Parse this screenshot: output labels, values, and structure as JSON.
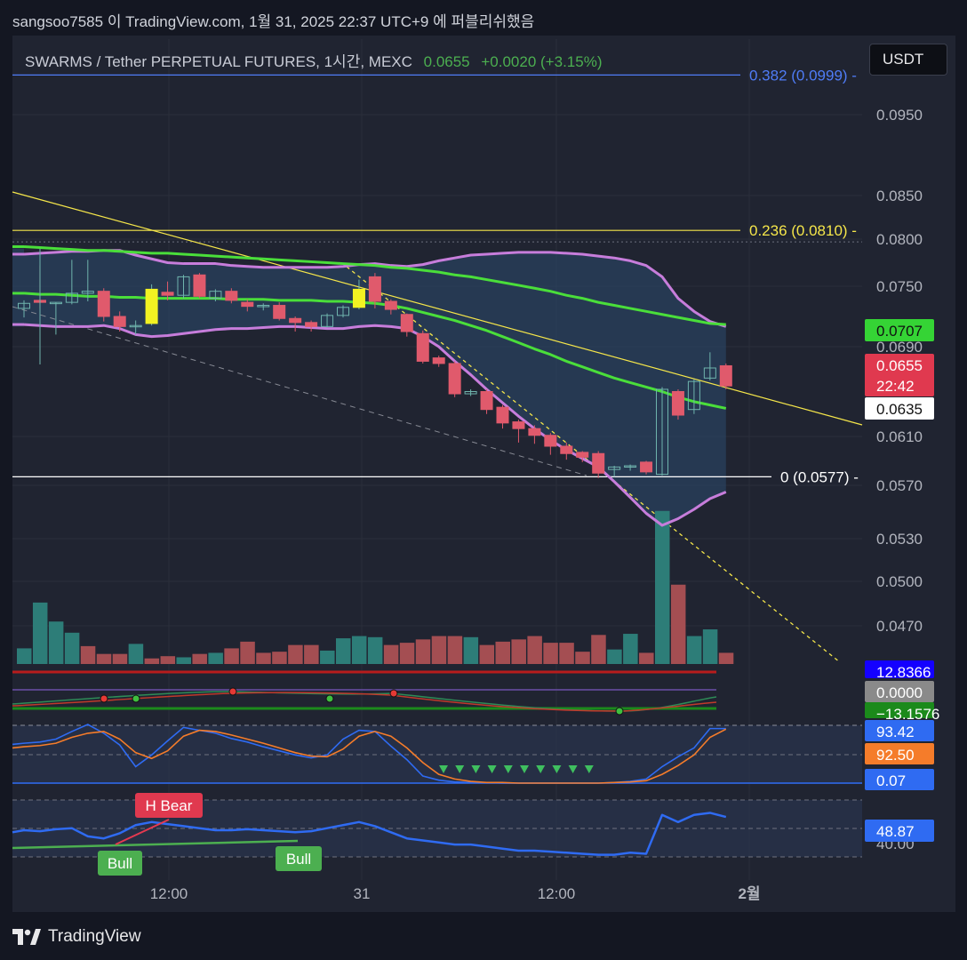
{
  "caption": "sangsoo7585 이 TradingView.com, 1월 31, 2025 22:37 UTC+9 에 퍼블리쉬했음",
  "header": {
    "symbol": "SWARMS / Tether PERPETUAL FUTURES, 1시간, MEXC",
    "price": "0.0655",
    "change": "+0.0020 (+3.15%)"
  },
  "currency_button": "USDT",
  "brand": "TradingView",
  "colors": {
    "background": "#202431",
    "up": "#26a69a",
    "down": "#ef5350",
    "bollinger": "#c77ddb",
    "ma": "#4ade3a",
    "fib_382": "#4f7cf6",
    "fib_236": "#f5e64a",
    "trendline": "#f5e64a",
    "rsi": "#2f6bf2"
  },
  "chart_data": {
    "type": "candlestick",
    "title": "SWARMS / Tether PERPETUAL FUTURES, 1시간, MEXC",
    "y_ticks": [
      "0.0950",
      "0.0850",
      "0.0800",
      "0.0750",
      "0.0690",
      "0.0610",
      "0.0570",
      "0.0530",
      "0.0500",
      "0.0470"
    ],
    "x_ticks": [
      "12:00",
      "31",
      "12:00",
      "2월"
    ],
    "fib_levels": [
      {
        "label": "0.382 (0.0999)",
        "value": 0.0999
      },
      {
        "label": "0.236 (0.0810)",
        "value": 0.081
      },
      {
        "label": "0 (0.0577)",
        "value": 0.0577
      }
    ],
    "price_tags": [
      {
        "label": "0.0707",
        "kind": "ma"
      },
      {
        "label": "0.0655",
        "sub": "22:42",
        "kind": "last"
      },
      {
        "label": "0.0635",
        "kind": "ma-lower"
      }
    ],
    "candles": [
      [
        0.0728,
        0.0733,
        0.0719,
        0.0736
      ],
      [
        0.0736,
        0.0734,
        0.0728,
        0.0772
      ],
      [
        0.0734,
        0.0734,
        0.0702,
        0.0734
      ],
      [
        0.0734,
        0.0743,
        0.0732,
        0.0778
      ],
      [
        0.0743,
        0.0745,
        0.0735,
        0.0778
      ],
      [
        0.0745,
        0.072,
        0.0715,
        0.0748
      ],
      [
        0.072,
        0.071,
        0.0705,
        0.0725
      ],
      [
        0.071,
        0.0711,
        0.0702,
        0.0716
      ],
      [
        0.0713,
        0.0747,
        0.0711,
        0.0752
      ],
      [
        0.0744,
        0.0741,
        0.0736,
        0.0755
      ],
      [
        0.0741,
        0.076,
        0.0738,
        0.0762
      ],
      [
        0.0762,
        0.074,
        0.0738,
        0.0764
      ],
      [
        0.0738,
        0.0745,
        0.0735,
        0.0747
      ],
      [
        0.0745,
        0.0736,
        0.0733,
        0.0748
      ],
      [
        0.0734,
        0.073,
        0.0725,
        0.0737
      ],
      [
        0.073,
        0.0731,
        0.0726,
        0.0733
      ],
      [
        0.0731,
        0.0718,
        0.0716,
        0.0734
      ],
      [
        0.0718,
        0.0714,
        0.0705,
        0.072
      ],
      [
        0.0714,
        0.071,
        0.0705,
        0.0716
      ],
      [
        0.071,
        0.0721,
        0.0709,
        0.0723
      ],
      [
        0.0721,
        0.0729,
        0.0719,
        0.0731
      ],
      [
        0.0729,
        0.0747,
        0.0727,
        0.0757
      ],
      [
        0.076,
        0.0735,
        0.0728,
        0.0764
      ],
      [
        0.0735,
        0.0727,
        0.0722,
        0.0737
      ],
      [
        0.0722,
        0.0705,
        0.07,
        0.0723
      ],
      [
        0.0703,
        0.0677,
        0.0675,
        0.0706
      ],
      [
        0.068,
        0.0675,
        0.0672,
        0.0682
      ],
      [
        0.0675,
        0.0648,
        0.0645,
        0.0677
      ],
      [
        0.0648,
        0.065,
        0.0646,
        0.0652
      ],
      [
        0.065,
        0.0634,
        0.063,
        0.0652
      ],
      [
        0.0636,
        0.0622,
        0.0617,
        0.0638
      ],
      [
        0.0623,
        0.0617,
        0.0605,
        0.0625
      ],
      [
        0.0617,
        0.0611,
        0.0604,
        0.062
      ],
      [
        0.0611,
        0.0602,
        0.0595,
        0.0613
      ],
      [
        0.0602,
        0.0596,
        0.0591,
        0.0605
      ],
      [
        0.0597,
        0.0593,
        0.0589,
        0.0598
      ],
      [
        0.0596,
        0.058,
        0.0576,
        0.0598
      ],
      [
        0.0583,
        0.0585,
        0.0577,
        0.0586
      ],
      [
        0.0585,
        0.0586,
        0.0582,
        0.0587
      ],
      [
        0.0589,
        0.0581,
        0.0579,
        0.059
      ],
      [
        0.0579,
        0.0652,
        0.0578,
        0.0654
      ],
      [
        0.065,
        0.0629,
        0.0625,
        0.0652
      ],
      [
        0.0634,
        0.0659,
        0.063,
        0.0661
      ],
      [
        0.0662,
        0.0671,
        0.066,
        0.0685
      ],
      [
        0.0673,
        0.0655,
        0.0652,
        0.0675
      ]
    ],
    "volume": [
      14,
      55,
      38,
      28,
      16,
      9,
      9,
      18,
      5,
      7,
      6,
      9,
      10,
      14,
      20,
      10,
      11,
      17,
      17,
      12,
      23,
      25,
      24,
      17,
      19,
      22,
      25,
      25,
      24,
      17,
      20,
      22,
      25,
      19,
      19,
      11,
      26,
      13,
      27,
      10,
      137,
      71,
      25,
      31,
      10
    ],
    "volume_up": [
      true,
      true,
      true,
      true,
      false,
      false,
      false,
      true,
      false,
      false,
      true,
      false,
      true,
      false,
      false,
      false,
      false,
      false,
      false,
      true,
      true,
      true,
      true,
      false,
      false,
      false,
      false,
      false,
      true,
      false,
      false,
      false,
      false,
      false,
      false,
      false,
      false,
      true,
      true,
      false,
      true,
      false,
      true,
      true,
      false
    ],
    "bb_upper": [
      0.0784,
      0.0785,
      0.0786,
      0.0787,
      0.0787,
      0.0788,
      0.0788,
      0.0783,
      0.0779,
      0.0775,
      0.0774,
      0.0774,
      0.0774,
      0.0772,
      0.0771,
      0.077,
      0.077,
      0.077,
      0.077,
      0.077,
      0.0771,
      0.0773,
      0.0774,
      0.0772,
      0.0771,
      0.0773,
      0.0777,
      0.078,
      0.0783,
      0.0784,
      0.0785,
      0.0786,
      0.0786,
      0.0786,
      0.0785,
      0.0784,
      0.0782,
      0.078,
      0.0777,
      0.0772,
      0.076,
      0.0738,
      0.0725,
      0.0715,
      0.071
    ],
    "bb_lower": [
      0.0712,
      0.0711,
      0.071,
      0.071,
      0.071,
      0.0711,
      0.0708,
      0.0702,
      0.07,
      0.0701,
      0.0703,
      0.0705,
      0.0707,
      0.0708,
      0.0708,
      0.0709,
      0.071,
      0.071,
      0.0709,
      0.0708,
      0.0708,
      0.071,
      0.0711,
      0.071,
      0.0708,
      0.07,
      0.069,
      0.0677,
      0.0665,
      0.0652,
      0.064,
      0.0628,
      0.0617,
      0.0607,
      0.0599,
      0.0592,
      0.0585,
      0.0573,
      0.0561,
      0.0549,
      0.054,
      0.0545,
      0.0552,
      0.056,
      0.0565
    ],
    "ma_long": [
      0.0792,
      0.0791,
      0.079,
      0.0789,
      0.0788,
      0.0788,
      0.0787,
      0.0786,
      0.0785,
      0.0785,
      0.0784,
      0.0783,
      0.0782,
      0.0781,
      0.078,
      0.0779,
      0.0778,
      0.0777,
      0.0776,
      0.0775,
      0.0774,
      0.0773,
      0.0772,
      0.077,
      0.0769,
      0.0767,
      0.0765,
      0.0762,
      0.076,
      0.0757,
      0.0754,
      0.0751,
      0.0748,
      0.0745,
      0.0741,
      0.0738,
      0.0734,
      0.0731,
      0.0728,
      0.0725,
      0.0722,
      0.0719,
      0.0716,
      0.0713,
      0.0712
    ],
    "ma_short": [
      0.0743,
      0.0742,
      0.0742,
      0.0741,
      0.074,
      0.074,
      0.0739,
      0.0739,
      0.0738,
      0.0738,
      0.0738,
      0.0738,
      0.0738,
      0.0737,
      0.0737,
      0.0737,
      0.0736,
      0.0736,
      0.0736,
      0.0735,
      0.0735,
      0.0734,
      0.0733,
      0.0731,
      0.0728,
      0.0724,
      0.072,
      0.0716,
      0.0711,
      0.0706,
      0.07,
      0.0694,
      0.0688,
      0.0683,
      0.0677,
      0.0672,
      0.0667,
      0.0662,
      0.0658,
      0.0654,
      0.065,
      0.0645,
      0.0641,
      0.0638,
      0.0635
    ],
    "indicator1": {
      "labels": [
        "12.8366",
        "0.0000",
        "−13.1576"
      ]
    },
    "stoch": {
      "labels": [
        "93.42",
        "92.50",
        "0.07"
      ],
      "k": [
        68,
        70,
        75,
        88,
        100,
        85,
        65,
        28,
        48,
        72,
        95,
        90,
        85,
        76,
        70,
        62,
        55,
        48,
        43,
        48,
        75,
        90,
        88,
        63,
        40,
        12,
        5,
        2,
        1,
        1,
        0,
        0,
        0,
        0,
        0,
        0,
        0,
        1,
        3,
        7,
        28,
        45,
        60,
        93,
        93
      ],
      "d": [
        62,
        64,
        68,
        78,
        85,
        88,
        75,
        52,
        42,
        55,
        80,
        90,
        88,
        82,
        75,
        68,
        60,
        52,
        46,
        45,
        58,
        80,
        88,
        80,
        60,
        35,
        15,
        7,
        3,
        1,
        1,
        0,
        0,
        0,
        0,
        0,
        0,
        1,
        2,
        4,
        15,
        30,
        48,
        78,
        92
      ]
    },
    "rsi": {
      "labels": [
        "48.87",
        "40.00"
      ],
      "values": [
        40,
        39,
        41,
        42,
        34,
        32,
        37,
        45,
        48,
        46,
        44,
        42,
        40,
        40,
        41,
        40,
        39,
        38,
        39,
        42,
        45,
        48,
        44,
        38,
        32,
        30,
        28,
        26,
        26,
        24,
        22,
        20,
        20,
        19,
        18,
        17,
        16,
        16,
        18,
        17,
        55,
        48,
        55,
        57,
        53
      ]
    },
    "signal_labels": [
      {
        "label": "H Bear",
        "kind": "bear"
      },
      {
        "label": "Bull",
        "kind": "bull"
      },
      {
        "label": "Bull",
        "kind": "bull"
      }
    ]
  }
}
